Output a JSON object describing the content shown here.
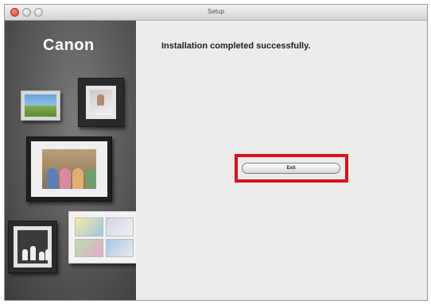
{
  "window": {
    "title": "Setup"
  },
  "sidebar": {
    "logo_text": "Canon"
  },
  "main": {
    "message": "Installation completed successfully.",
    "exit_label": "Exit"
  },
  "colors": {
    "highlight_border": "#d8121b",
    "sidebar_dark": "#3c3c3c",
    "content_background": "#ececec"
  }
}
